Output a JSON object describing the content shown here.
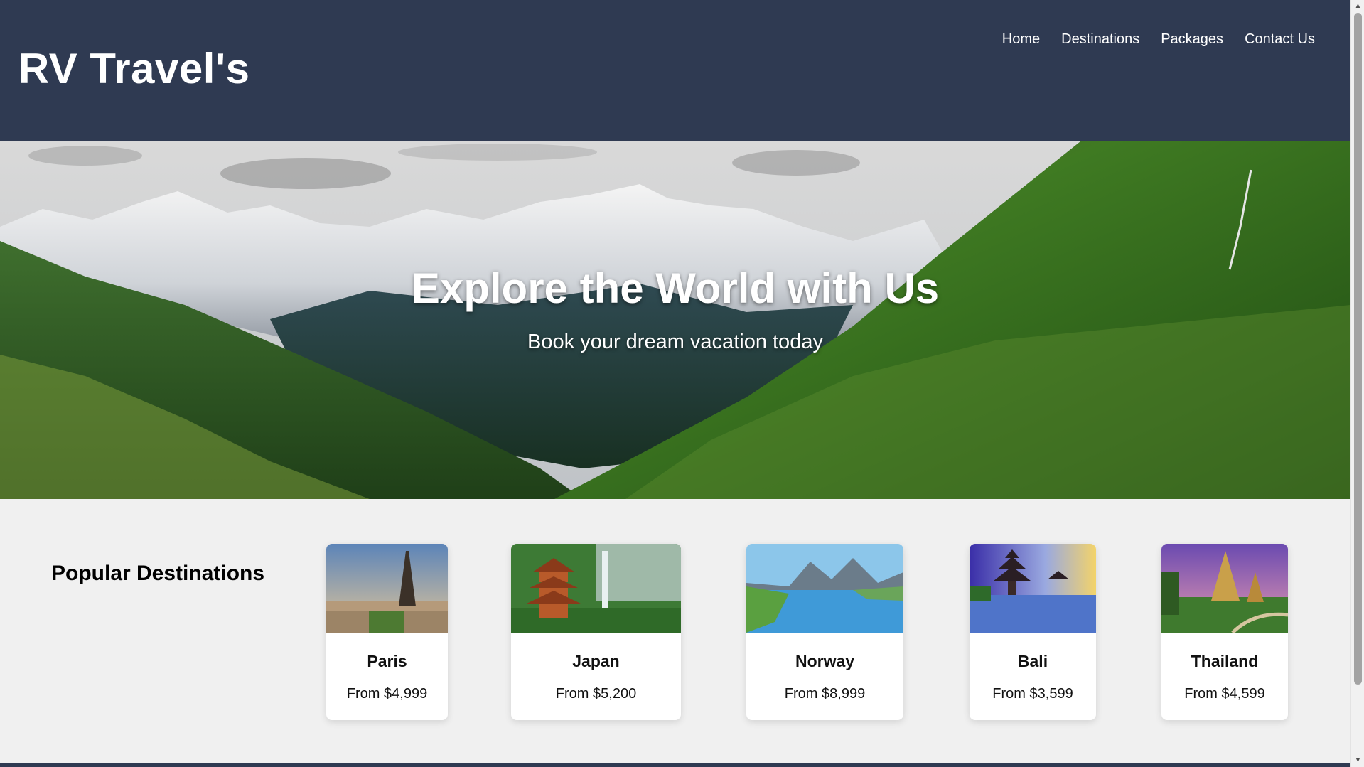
{
  "brand": {
    "name": "RV Travel's"
  },
  "nav": {
    "items": [
      {
        "label": "Home"
      },
      {
        "label": "Destinations"
      },
      {
        "label": "Packages"
      },
      {
        "label": "Contact Us"
      }
    ]
  },
  "hero": {
    "title": "Explore the World with Us",
    "subtitle": "Book your dream vacation today"
  },
  "destinations": {
    "heading": "Popular Destinations",
    "cards": [
      {
        "name": "Paris",
        "price": "From $4,999"
      },
      {
        "name": "Japan",
        "price": "From $5,200"
      },
      {
        "name": "Norway",
        "price": "From $8,999"
      },
      {
        "name": "Bali",
        "price": "From $3,599"
      },
      {
        "name": "Thailand",
        "price": "From $4,599"
      }
    ]
  },
  "colors": {
    "header_bg": "#2f3a52",
    "section_bg": "#f0f0f0",
    "text_on_dark": "#ffffff"
  }
}
